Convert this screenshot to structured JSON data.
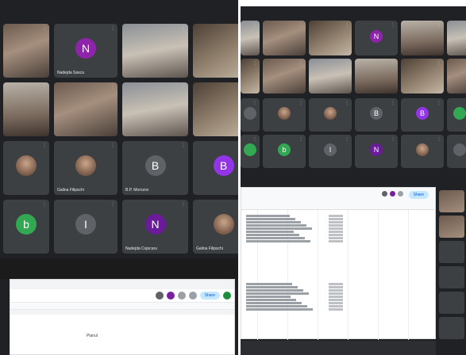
{
  "left_meeting": {
    "tiles": [
      {
        "name": "",
        "kind": "video",
        "variant": "v1"
      },
      {
        "name": "Nadejda Sasca",
        "kind": "avatar",
        "letter": "N",
        "color": "#8e24aa"
      },
      {
        "name": "",
        "kind": "video",
        "variant": "v2"
      },
      {
        "name": "",
        "kind": "video",
        "variant": "v3"
      },
      {
        "name": "",
        "kind": "video",
        "variant": "v4"
      },
      {
        "name": "",
        "kind": "video",
        "variant": "v1"
      },
      {
        "name": "",
        "kind": "video",
        "variant": "v2"
      },
      {
        "name": "",
        "kind": "video",
        "variant": "v3"
      },
      {
        "name": "",
        "kind": "photo"
      },
      {
        "name": "Galina Filipschi",
        "kind": "photo"
      },
      {
        "name": "B.P. Morozov",
        "kind": "avatar",
        "letter": "B",
        "color": "#5f6368"
      },
      {
        "name": "",
        "kind": "avatar",
        "letter": "B",
        "color": "#9334e6"
      },
      {
        "name": "",
        "kind": "avatar",
        "letter": "b",
        "color": "#33a852"
      },
      {
        "name": "",
        "kind": "avatar",
        "letter": "I",
        "color": "#5f6368"
      },
      {
        "name": "Nadejda Cojocaru",
        "kind": "avatar",
        "letter": "N",
        "color": "#6a1b9a"
      },
      {
        "name": "Galina Filipschi",
        "kind": "photo"
      }
    ]
  },
  "right_meeting": {
    "tiles_top": [
      {
        "name": "",
        "kind": "video",
        "variant": "v2"
      },
      {
        "name": "",
        "kind": "video",
        "variant": "v1"
      },
      {
        "name": "",
        "kind": "video",
        "variant": "v3"
      },
      {
        "name": "",
        "kind": "avatar",
        "letter": "N",
        "color": "#8e24aa"
      },
      {
        "name": "",
        "kind": "video",
        "variant": "v4"
      },
      {
        "name": "",
        "kind": "video",
        "variant": "v2"
      },
      {
        "name": "",
        "kind": "video",
        "variant": "v3"
      },
      {
        "name": "",
        "kind": "video",
        "variant": "v1"
      },
      {
        "name": "",
        "kind": "video",
        "variant": "v2"
      },
      {
        "name": "",
        "kind": "video",
        "variant": "v4"
      },
      {
        "name": "",
        "kind": "video",
        "variant": "v3"
      },
      {
        "name": "",
        "kind": "video",
        "variant": "v1"
      }
    ],
    "tiles_bottom": [
      {
        "name": "",
        "kind": "avatar",
        "letter": "",
        "color": "#5f6368"
      },
      {
        "name": "",
        "kind": "photo"
      },
      {
        "name": "",
        "kind": "photo"
      },
      {
        "name": "",
        "kind": "avatar",
        "letter": "B",
        "color": "#5f6368"
      },
      {
        "name": "",
        "kind": "avatar",
        "letter": "B",
        "color": "#9334e6"
      },
      {
        "name": "",
        "kind": "avatar",
        "letter": "",
        "color": "#33a852"
      },
      {
        "name": "",
        "kind": "avatar",
        "letter": "",
        "color": "#33a852"
      },
      {
        "name": "",
        "kind": "avatar",
        "letter": "b",
        "color": "#33a852"
      },
      {
        "name": "",
        "kind": "avatar",
        "letter": "I",
        "color": "#5f6368"
      },
      {
        "name": "",
        "kind": "avatar",
        "letter": "N",
        "color": "#6a1b9a"
      },
      {
        "name": "",
        "kind": "photo"
      },
      {
        "name": "",
        "kind": "avatar",
        "letter": "",
        "color": "#5f6368"
      }
    ]
  },
  "doc_window": {
    "share_label": "Share",
    "body_heading": "Planul"
  },
  "sheet_window": {
    "share_label": "Share"
  },
  "colors": {
    "meet_bg": "#202124",
    "tile_bg": "#3c4043",
    "share_bg": "#c2e7ff"
  }
}
